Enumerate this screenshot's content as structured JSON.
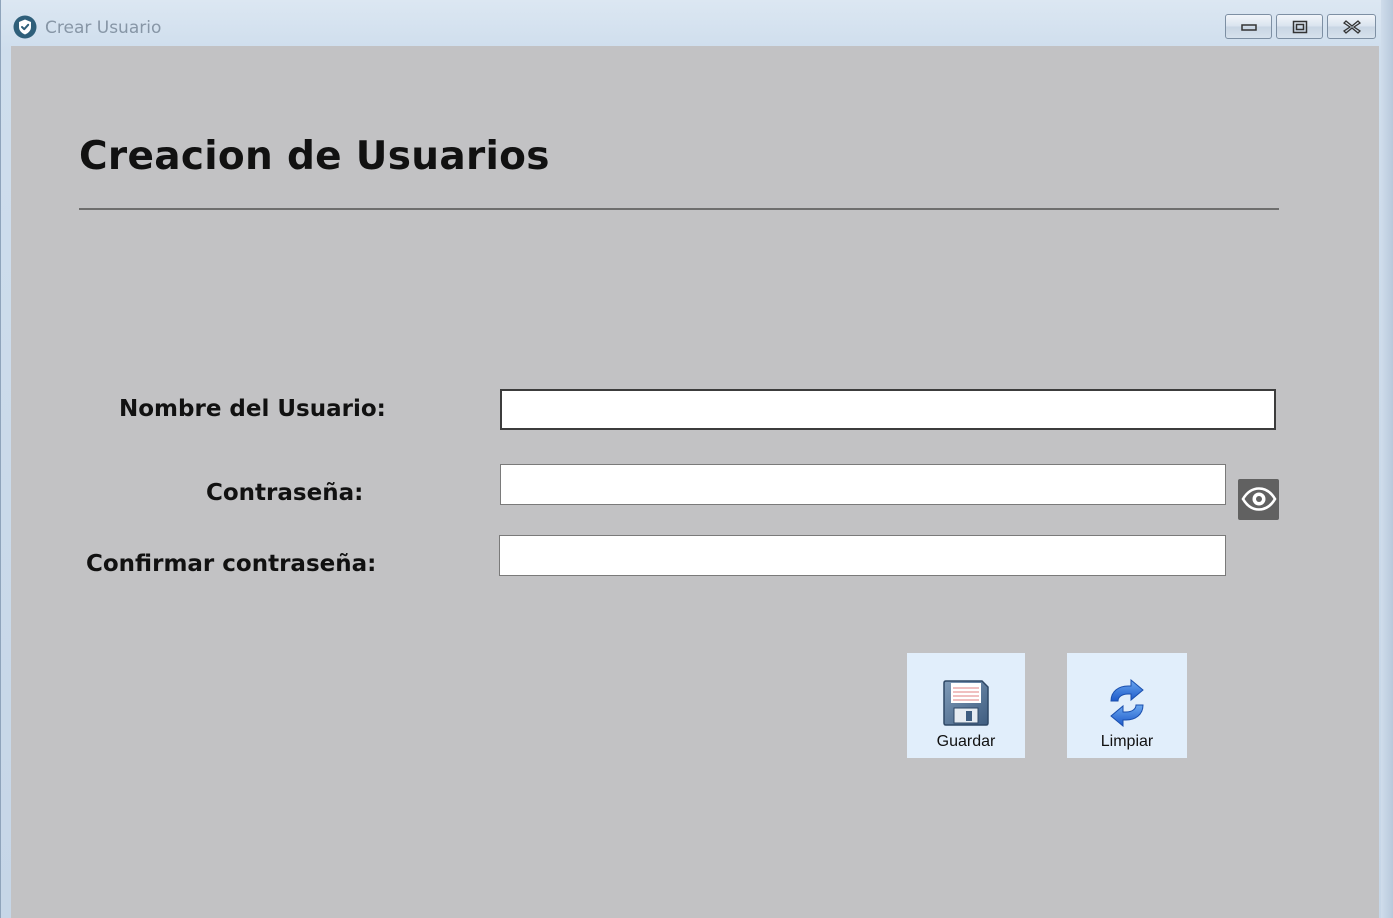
{
  "window": {
    "title": "Crear Usuario"
  },
  "form": {
    "heading": "Creacion de Usuarios",
    "fields": {
      "username_label": "Nombre del Usuario:",
      "username_value": "",
      "password_label": "Contraseña:",
      "password_value": "",
      "confirm_label": "Confirmar contraseña:",
      "confirm_value": ""
    }
  },
  "actions": {
    "save_label": "Guardar",
    "clear_label": "Limpiar"
  },
  "icons": {
    "app": "shield-check-icon",
    "show_password": "eye-icon",
    "save": "floppy-disk-icon",
    "clear": "refresh-icon"
  },
  "colors": {
    "client_bg": "#c2c2c4",
    "button_bg": "#e1eefb",
    "eye_button_bg": "#616161"
  }
}
